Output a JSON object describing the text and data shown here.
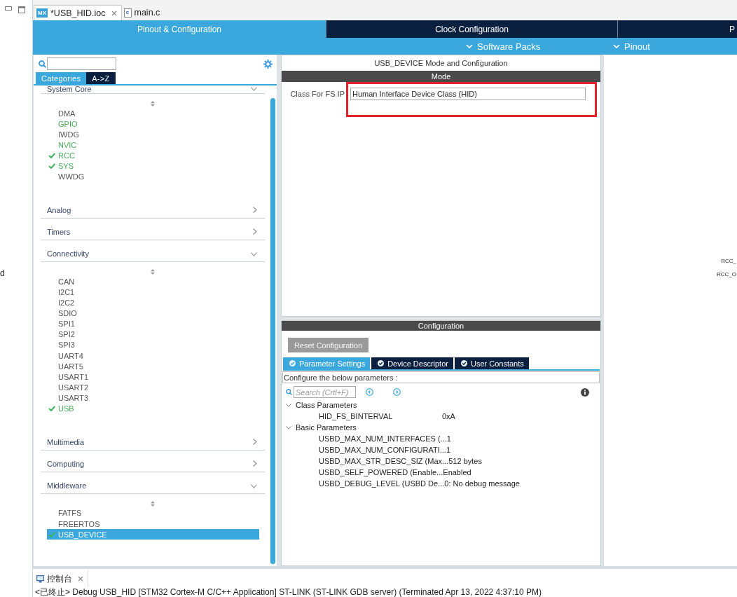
{
  "side_view": {
    "cut_text": "d"
  },
  "editor_tabs": [
    {
      "label": "*USB_HID.ioc",
      "badge": "MX",
      "kind": "ioc",
      "closable": true,
      "selected": true
    },
    {
      "label": "main.c",
      "badge": "c",
      "kind": "source",
      "closable": false,
      "selected": false
    }
  ],
  "top_tabs": [
    {
      "label": "Pinout & Configuration",
      "selected": true
    },
    {
      "label": "Clock Configuration",
      "selected": false
    },
    {
      "label": "P",
      "selected": false
    }
  ],
  "menus": [
    {
      "label": "Software Packs"
    },
    {
      "label": "Pinout"
    }
  ],
  "categories_panel": {
    "view_tabs": [
      {
        "label": "Categories",
        "selected": true
      },
      {
        "label": "A->Z",
        "selected": false
      }
    ],
    "categories": [
      {
        "label": "System Core",
        "expanded": true,
        "items": [
          {
            "label": "DMA",
            "configured": false,
            "checked": false,
            "selected": false
          },
          {
            "label": "GPIO",
            "configured": true,
            "checked": false,
            "selected": false
          },
          {
            "label": "IWDG",
            "configured": false,
            "checked": false,
            "selected": false
          },
          {
            "label": "NVIC",
            "configured": true,
            "checked": false,
            "selected": false
          },
          {
            "label": "RCC",
            "configured": true,
            "checked": true,
            "selected": false
          },
          {
            "label": "SYS",
            "configured": true,
            "checked": true,
            "selected": false
          },
          {
            "label": "WWDG",
            "configured": false,
            "checked": false,
            "selected": false
          }
        ]
      },
      {
        "label": "Analog",
        "expanded": false
      },
      {
        "label": "Timers",
        "expanded": false
      },
      {
        "label": "Connectivity",
        "expanded": true,
        "items": [
          {
            "label": "CAN",
            "configured": false,
            "checked": false,
            "selected": false
          },
          {
            "label": "I2C1",
            "configured": false,
            "checked": false,
            "selected": false
          },
          {
            "label": "I2C2",
            "configured": false,
            "checked": false,
            "selected": false
          },
          {
            "label": "SDIO",
            "configured": false,
            "checked": false,
            "selected": false
          },
          {
            "label": "SPI1",
            "configured": false,
            "checked": false,
            "selected": false
          },
          {
            "label": "SPI2",
            "configured": false,
            "checked": false,
            "selected": false
          },
          {
            "label": "SPI3",
            "configured": false,
            "checked": false,
            "selected": false
          },
          {
            "label": "UART4",
            "configured": false,
            "checked": false,
            "selected": false
          },
          {
            "label": "UART5",
            "configured": false,
            "checked": false,
            "selected": false
          },
          {
            "label": "USART1",
            "configured": false,
            "checked": false,
            "selected": false
          },
          {
            "label": "USART2",
            "configured": false,
            "checked": false,
            "selected": false
          },
          {
            "label": "USART3",
            "configured": false,
            "checked": false,
            "selected": false
          },
          {
            "label": "USB",
            "configured": true,
            "checked": true,
            "selected": false
          }
        ]
      },
      {
        "label": "Multimedia",
        "expanded": false
      },
      {
        "label": "Computing",
        "expanded": false
      },
      {
        "label": "Middleware",
        "expanded": true,
        "items": [
          {
            "label": "FATFS",
            "configured": false,
            "checked": false,
            "selected": false
          },
          {
            "label": "FREERTOS",
            "configured": false,
            "checked": false,
            "selected": false
          },
          {
            "label": "USB_DEVICE",
            "configured": true,
            "checked": true,
            "selected": true
          }
        ]
      }
    ]
  },
  "mode_panel": {
    "title": "USB_DEVICE Mode and Configuration",
    "header": "Mode",
    "fields": [
      {
        "label": "Class For FS IP",
        "value": "Human Interface Device Class (HID)",
        "highlighted": true
      }
    ]
  },
  "config_panel": {
    "header": "Configuration",
    "reset_button": "Reset Configuration",
    "tabs": [
      {
        "label": "Parameter Settings",
        "selected": true
      },
      {
        "label": "Device Descriptor",
        "selected": false
      },
      {
        "label": "User Constants",
        "selected": false
      }
    ],
    "hint": "Configure the below parameters :",
    "search": {
      "placeholder": "Search (Crtl+F)"
    },
    "groups": [
      {
        "label": "Class Parameters",
        "expanded": true,
        "params": [
          {
            "name": "HID_FS_BINTERVAL",
            "value": "0xA"
          }
        ]
      },
      {
        "label": "Basic Parameters",
        "expanded": true,
        "params": [
          {
            "name": "USBD_MAX_NUM_INTERFACES (...",
            "value": "1"
          },
          {
            "name": "USBD_MAX_NUM_CONFIGURATI...",
            "value": "1"
          },
          {
            "name": "USBD_MAX_STR_DESC_SIZ (Max...",
            "value": "512 bytes"
          },
          {
            "name": "USBD_SELF_POWERED (Enable...",
            "value": "Enabled"
          },
          {
            "name": "USBD_DEBUG_LEVEL (USBD De...",
            "value": "0: No debug message"
          }
        ]
      }
    ]
  },
  "pinout_view": {
    "pin_labels": [
      "RCC_",
      "RCC_O"
    ]
  },
  "console": {
    "tab": "控制台",
    "closable": true,
    "line": "<已终止> Debug USB_HID [STM32 Cortex-M C/C++ Application] ST-LINK (ST-LINK GDB server) (Terminated Apr 13, 2022 4:37:10 PM)"
  }
}
